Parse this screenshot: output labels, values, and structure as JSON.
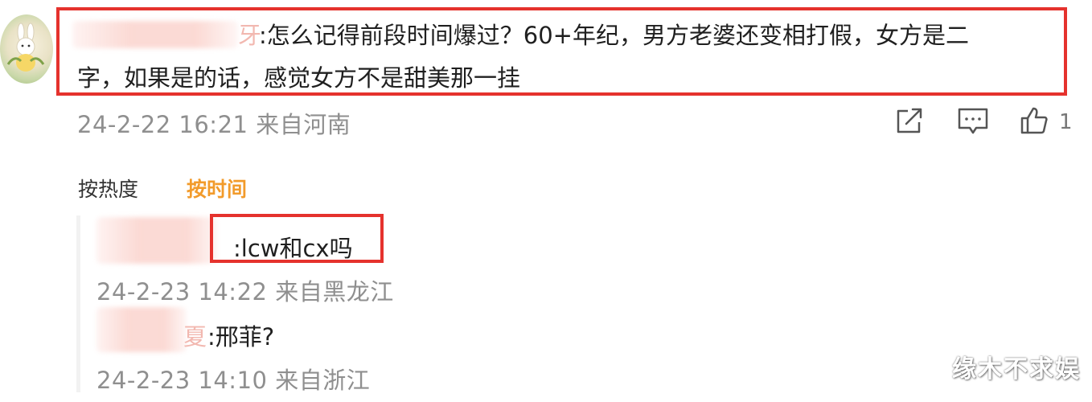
{
  "comment": {
    "username_suffix": "牙",
    "text_line1": ":怎么记得前段时间爆过？60+年纪，男方老婆还变相打假，女方是二",
    "text_line2": "字，如果是的话，感觉女方不是甜美那一挂",
    "timestamp": "24-2-22 16:21 来自河南",
    "like_count": "1",
    "icons": [
      "share-icon",
      "comment-icon",
      "like-icon"
    ]
  },
  "sort": {
    "hot_label": "按热度",
    "time_label": "按时间",
    "active_color": "#f29b2b"
  },
  "replies": [
    {
      "text": ":lcw和cx吗",
      "timestamp": "24-2-23 14:22 来自黑龙江"
    },
    {
      "username_suffix": "夏",
      "text": ":邢菲?",
      "timestamp": "24-2-23 14:10 来自浙江"
    }
  ],
  "watermark": "缘木不求娱",
  "colors": {
    "highlight_box": "#e5322d",
    "meta_text": "#8f8f8f"
  }
}
